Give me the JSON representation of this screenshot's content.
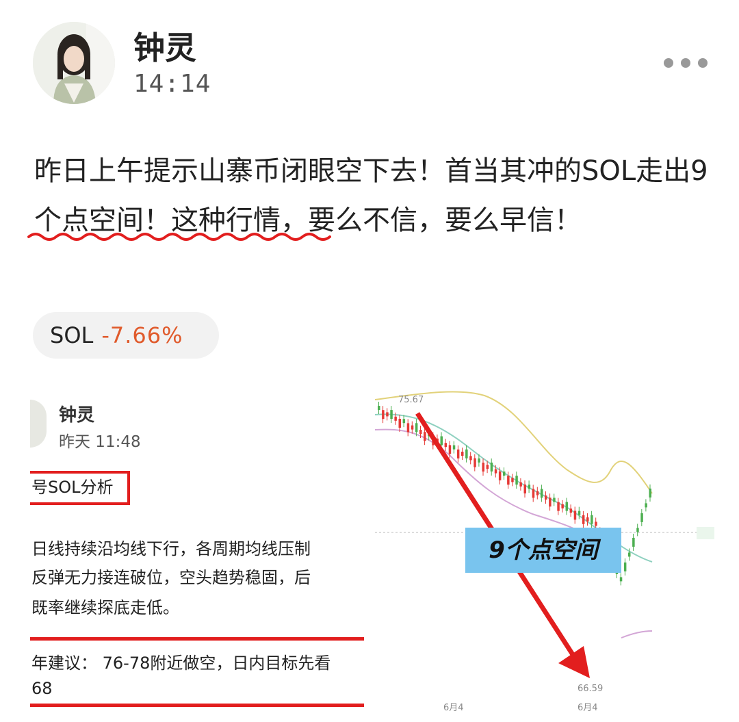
{
  "post": {
    "author": "钟灵",
    "time": "14:14",
    "text_before": "昨日上午提示山寨币闭眼空下去！首当其冲的",
    "text_highlight": "SOL走出9个点空间！",
    "text_after": "这种行情，要么不信，要么早信！",
    "icons": [
      "avatar",
      "more-icon"
    ]
  },
  "tag": {
    "symbol": "SOL",
    "change": "-7.66%",
    "change_color": "#e05a2b"
  },
  "embed": {
    "author": "钟灵",
    "time": "昨天 11:48",
    "title": "号SOL分析",
    "lines": [
      "日线持续沿均线下行，各周期均线压制",
      "反弹无力接连破位，空头趋势稳固，后",
      "既率继续探底走低。",
      "年建议：  76-78附近做空，日内目标先看",
      "68"
    ],
    "accent_color": "#e21e1e"
  },
  "chart_data": {
    "type": "candlestick",
    "high_label": "75.67",
    "low_label": "66.59",
    "x_tick_labels": [
      "6月4",
      "6月4"
    ],
    "annotation": "9个点空间",
    "annotation_color": "#79c4ee",
    "arrow_color": "#e21e1e"
  }
}
